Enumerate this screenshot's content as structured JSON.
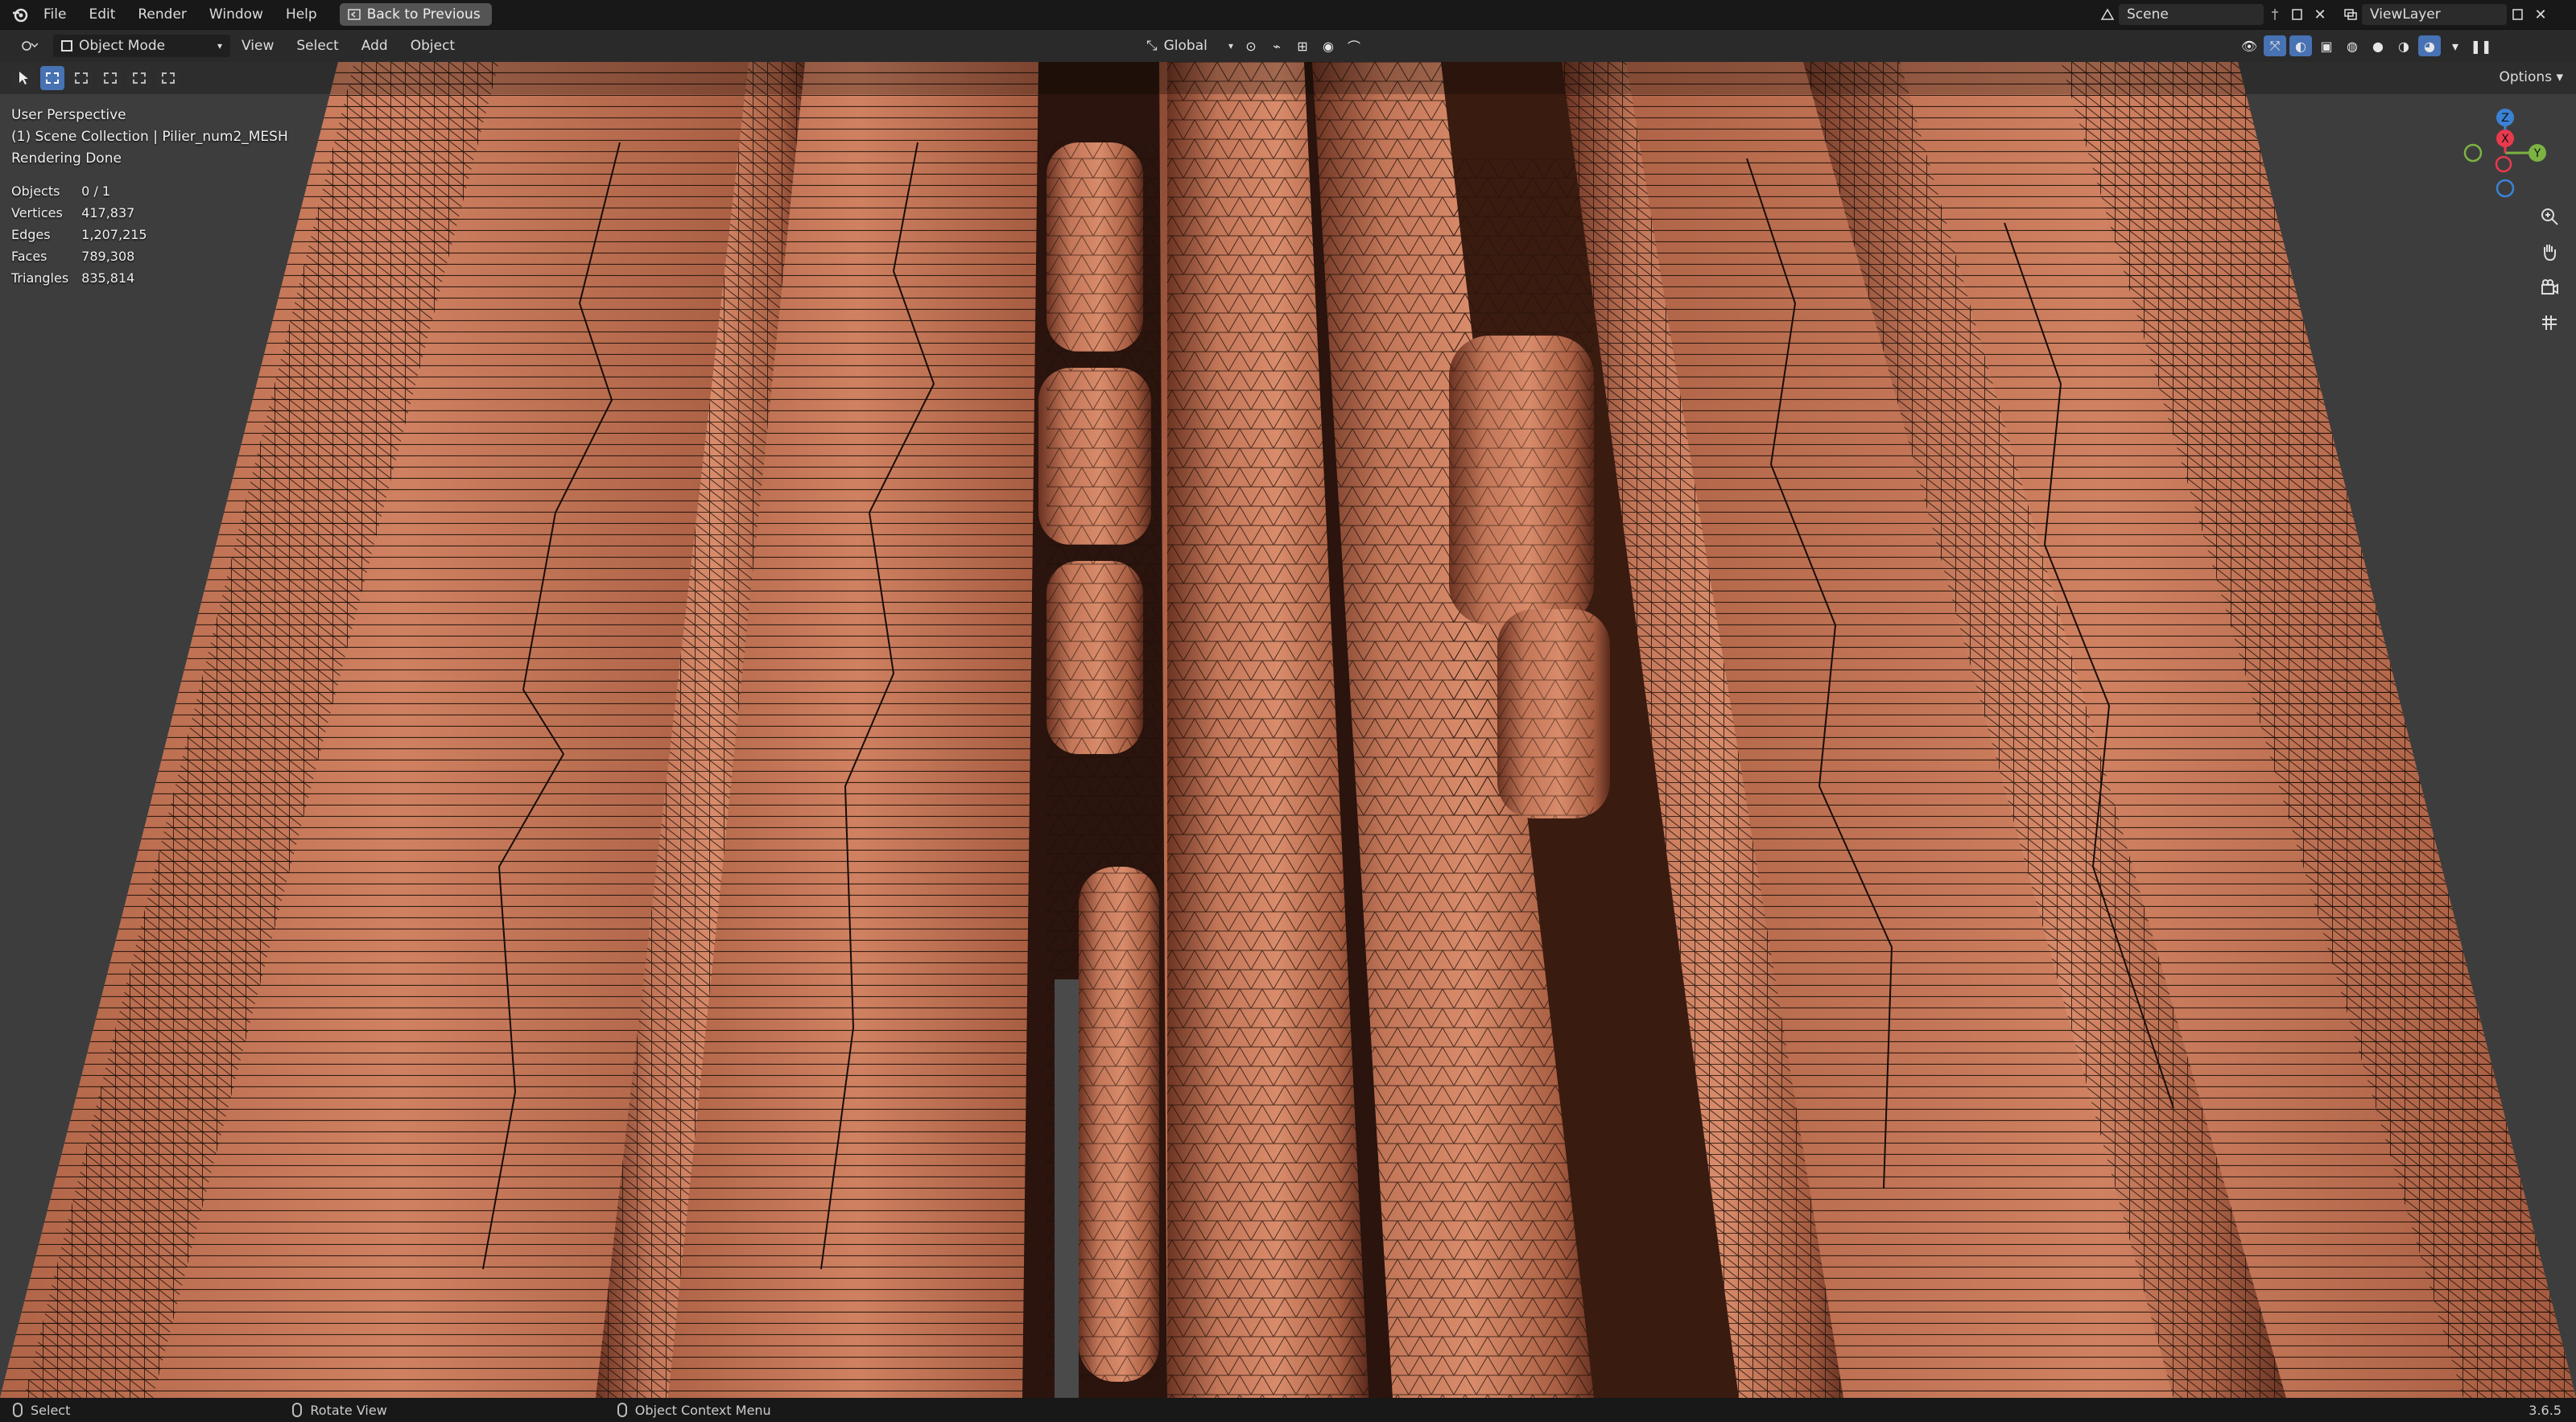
{
  "topbar": {
    "menus": [
      "File",
      "Edit",
      "Render",
      "Window",
      "Help"
    ],
    "back_label": "Back to Previous",
    "scene_name": "Scene",
    "view_layer": "ViewLayer"
  },
  "header": {
    "mode": "Object Mode",
    "menus": [
      "View",
      "Select",
      "Add",
      "Object"
    ],
    "orientation": "Global",
    "options_label": "Options"
  },
  "overlay": {
    "perspective": "User Perspective",
    "collection": "(1) Scene Collection | Pilier_num2_MESH",
    "render_status": "Rendering Done"
  },
  "stats": [
    {
      "label": "Objects",
      "value": "0 / 1"
    },
    {
      "label": "Vertices",
      "value": "417,837"
    },
    {
      "label": "Edges",
      "value": "1,207,215"
    },
    {
      "label": "Faces",
      "value": "789,308"
    },
    {
      "label": "Triangles",
      "value": "835,814"
    }
  ],
  "gizmo": {
    "z": "Z",
    "x": "X",
    "y": "Y"
  },
  "statusbar": {
    "select": "Select",
    "rotate": "Rotate View",
    "context": "Object Context Menu",
    "version": "3.6.5"
  },
  "colors": {
    "mesh_base": "#b8684a",
    "mesh_light": "#d88a6a",
    "mesh_dark": "#6b3322",
    "wire": "#1a0d08",
    "accent_blue": "#4772b3",
    "axis_x": "#e8394d",
    "axis_y": "#7cb342",
    "axis_z": "#3b82d6"
  },
  "icons": [
    "blender-logo-icon",
    "back-icon",
    "pin-icon",
    "viewport-shading-icons",
    "zoom-icon",
    "hand-icon",
    "camera-icon",
    "grid-icon"
  ]
}
